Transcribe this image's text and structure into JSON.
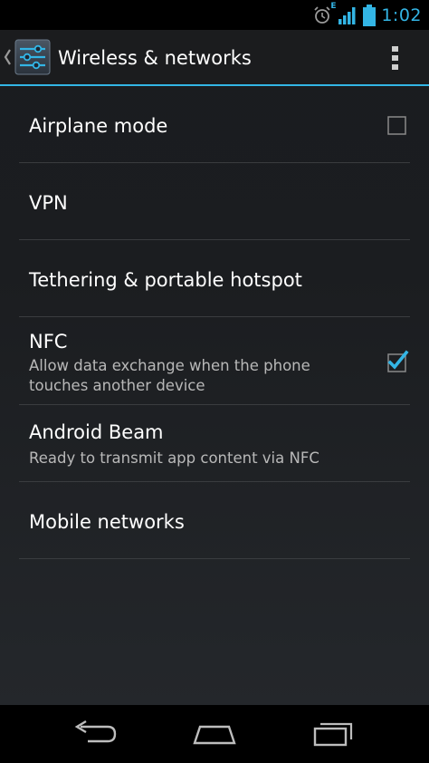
{
  "status_bar": {
    "time": "1:02",
    "network_type": "E",
    "icons": [
      "alarm-icon",
      "signal-icon",
      "battery-icon"
    ],
    "accent_color": "#33b5e5"
  },
  "action_bar": {
    "title": "Wireless & networks",
    "up_icon": "chevron-left-icon",
    "app_icon": "settings-sliders-icon",
    "overflow_icon": "overflow-menu-icon"
  },
  "settings": {
    "airplane": {
      "title": "Airplane mode",
      "checked": false
    },
    "vpn": {
      "title": "VPN"
    },
    "tethering": {
      "title": "Tethering & portable hotspot"
    },
    "nfc": {
      "title": "NFC",
      "summary_line1": "Allow data exchange when the phone",
      "summary_line2": "touches another device",
      "checked": true
    },
    "beam": {
      "title": "Android Beam",
      "summary": "Ready to transmit app content via NFC"
    },
    "mobile": {
      "title": "Mobile networks"
    }
  },
  "nav_bar": {
    "icons": [
      "back-icon",
      "home-icon",
      "recent-apps-icon"
    ]
  }
}
